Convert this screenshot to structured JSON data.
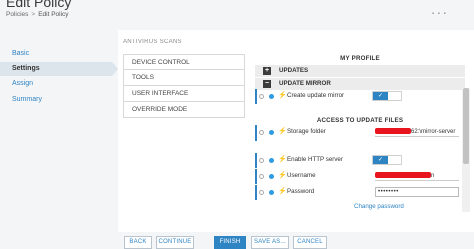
{
  "header": {
    "title": "Edit Policy",
    "breadcrumb_parent": "Policies",
    "breadcrumb_sep": ">",
    "breadcrumb_current": "Edit Policy"
  },
  "nav": {
    "items": [
      {
        "label": "Basic"
      },
      {
        "label": "Settings",
        "active": true
      },
      {
        "label": "Assign"
      },
      {
        "label": "Summary"
      }
    ]
  },
  "categories": {
    "clipped_top": "ANTIVIRUS SCANS",
    "items": [
      {
        "label": "DEVICE CONTROL"
      },
      {
        "label": "TOOLS"
      },
      {
        "label": "USER INTERFACE"
      },
      {
        "label": "OVERRIDE MODE"
      }
    ]
  },
  "tree": {
    "my_profile_title": "MY PROFILE",
    "groups": [
      {
        "label": "UPDATES",
        "symbol": "+"
      },
      {
        "label": "UPDATE MIRROR",
        "symbol": "−"
      }
    ],
    "create_update_mirror": {
      "label": "Create update mirror",
      "toggle": "✓"
    },
    "access_title": "ACCESS TO UPDATE FILES",
    "storage_folder": {
      "label": "Storage folder",
      "value_tail": ":\\mirror-server",
      "value_prefix": "62"
    },
    "enable_http": {
      "label": "Enable HTTP server",
      "toggle": "✓"
    },
    "username": {
      "label": "Username",
      "value_tail": "n"
    },
    "password": {
      "label": "Password",
      "value": "••••••••"
    },
    "change_password": "Change password"
  },
  "footer": {
    "back": "BACK",
    "continue": "CONTINUE",
    "finish": "FINISH",
    "save_as": "SAVE AS...",
    "cancel": "CANCEL"
  },
  "colors": {
    "accent": "#2f84c4",
    "redaction": "#e8141e",
    "status_dot": "#2f9be0"
  }
}
